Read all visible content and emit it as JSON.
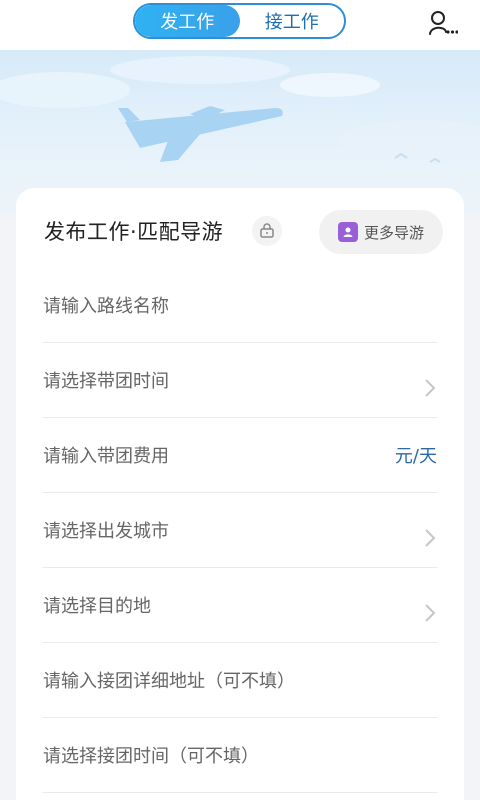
{
  "header": {
    "tabs": [
      {
        "label": "发工作",
        "active": true
      },
      {
        "label": "接工作",
        "active": false
      }
    ],
    "user_icon": "user-search-icon"
  },
  "card": {
    "title": "发布工作·匹配导游",
    "title_icon": "lock-icon",
    "more_button": {
      "label": "更多导游",
      "icon": "guide-badge-icon"
    }
  },
  "form": {
    "rows": [
      {
        "placeholder": "请输入路线名称"
      },
      {
        "placeholder": "请选择带团时间",
        "chevron": true
      },
      {
        "placeholder": "请输入带团费用",
        "suffix": "元/天"
      },
      {
        "placeholder": "请选择出发城市",
        "chevron": true
      },
      {
        "placeholder": "请选择目的地",
        "chevron": true
      },
      {
        "placeholder": "请输入接团详细地址（可不填）"
      },
      {
        "placeholder": "请选择接团时间（可不填）"
      }
    ]
  },
  "colors": {
    "accent": "#2fb2f2",
    "tab_border": "#2e8fd6",
    "suffix_text": "#2c6aa6",
    "badge_purple": "#9a5fd6"
  }
}
